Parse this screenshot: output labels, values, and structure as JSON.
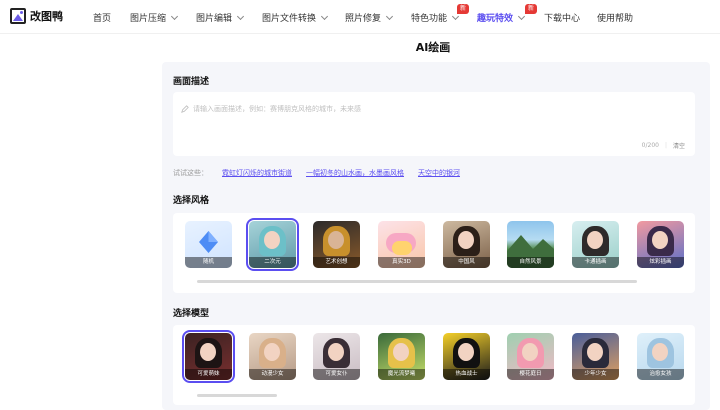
{
  "app": {
    "logo_text": "改图鸭"
  },
  "nav": {
    "items": [
      {
        "label": "首页",
        "has_chevron": false
      },
      {
        "label": "图片压缩",
        "has_chevron": true
      },
      {
        "label": "图片编辑",
        "has_chevron": true
      },
      {
        "label": "图片文件转换",
        "has_chevron": true
      },
      {
        "label": "照片修复",
        "has_chevron": true
      },
      {
        "label": "特色功能",
        "has_chevron": true,
        "badge": "新"
      },
      {
        "label": "趣玩特效",
        "has_chevron": true,
        "badge": "新",
        "active": true
      },
      {
        "label": "下载中心",
        "has_chevron": false
      },
      {
        "label": "使用帮助",
        "has_chevron": false
      }
    ]
  },
  "page_title": "AI绘画",
  "prompt": {
    "section_title": "画面描述",
    "placeholder": "请输入画面描述，例如：赛博朋克风格的城市，未来感",
    "counter": "0/200",
    "separator": "|",
    "clear_label": "清空"
  },
  "try": {
    "label": "试试这些：",
    "links": [
      "霓虹灯闪烁的城市街道",
      "一幅初冬的山水画，水墨画风格",
      "天空中的银河"
    ]
  },
  "styles": {
    "section_title": "选择风格",
    "selected_index": 1,
    "items": [
      {
        "label": "随机",
        "icon": "diamond-icon"
      },
      {
        "label": "二次元"
      },
      {
        "label": "艺术创想"
      },
      {
        "label": "真实3D"
      },
      {
        "label": "中国风"
      },
      {
        "label": "自然风景"
      },
      {
        "label": "卡通插画"
      },
      {
        "label": "炫彩插画"
      }
    ]
  },
  "models": {
    "section_title": "选择模型",
    "selected_index": 0,
    "items": [
      {
        "label": "可爱萌妹"
      },
      {
        "label": "动漫少女"
      },
      {
        "label": "可爱女仆"
      },
      {
        "label": "魔光流梦曦"
      },
      {
        "label": "热血战士"
      },
      {
        "label": "樱花庭日"
      },
      {
        "label": "少年少女"
      },
      {
        "label": "治愈女孩"
      }
    ]
  },
  "colors": {
    "accent": "#5b4ef0",
    "badge": "#e53935",
    "panel": "#f5f6fa"
  }
}
